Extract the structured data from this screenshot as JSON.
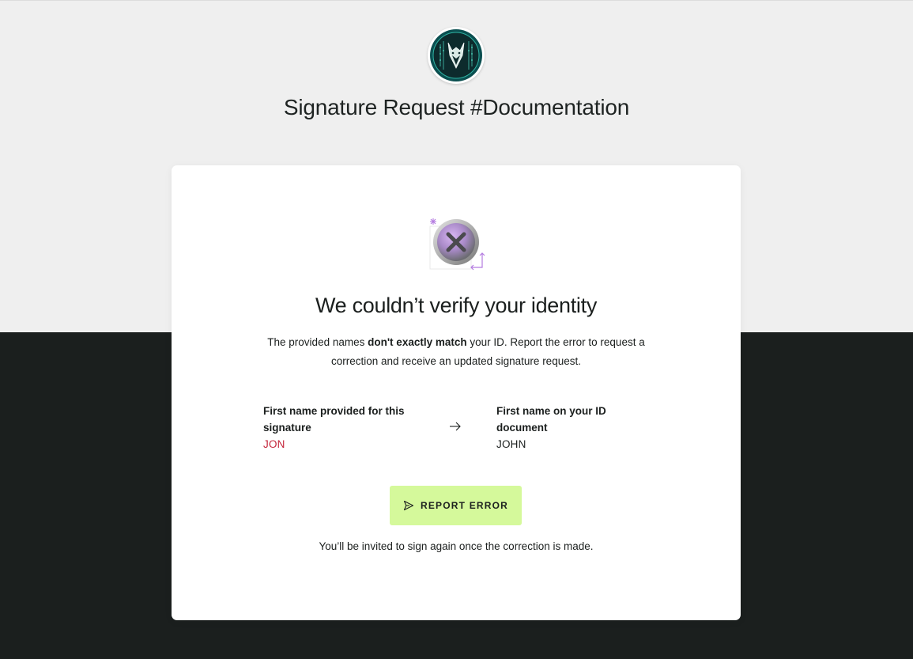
{
  "header": {
    "logo_icon": "fox-crest-logo-icon",
    "title": "Signature Request #Documentation"
  },
  "card": {
    "status_icon": "verification-failed-icon",
    "heading": "We couldn’t verify your identity",
    "message": {
      "before": "The provided names ",
      "emphasis": "don't exactly match",
      "after": " your ID. Report the error to request a correction and receive an updated signature request."
    },
    "provided_name": {
      "label": "First name provided for this signature",
      "value": "JON"
    },
    "document_name": {
      "label": "First name on your ID document",
      "value": "JOHN"
    },
    "report_button": {
      "label": "REPORT ERROR",
      "icon": "send-icon"
    },
    "footnote": "You’ll be invited to sign again once the correction is made."
  },
  "colors": {
    "top_background": "#efefef",
    "bottom_background": "#1b1f1e",
    "card_background": "#ffffff",
    "button_background": "#d5f99b",
    "mismatch_text": "#c4253a",
    "logo_ring": "#0c5a5a",
    "icon_accent": "#b47be0"
  }
}
